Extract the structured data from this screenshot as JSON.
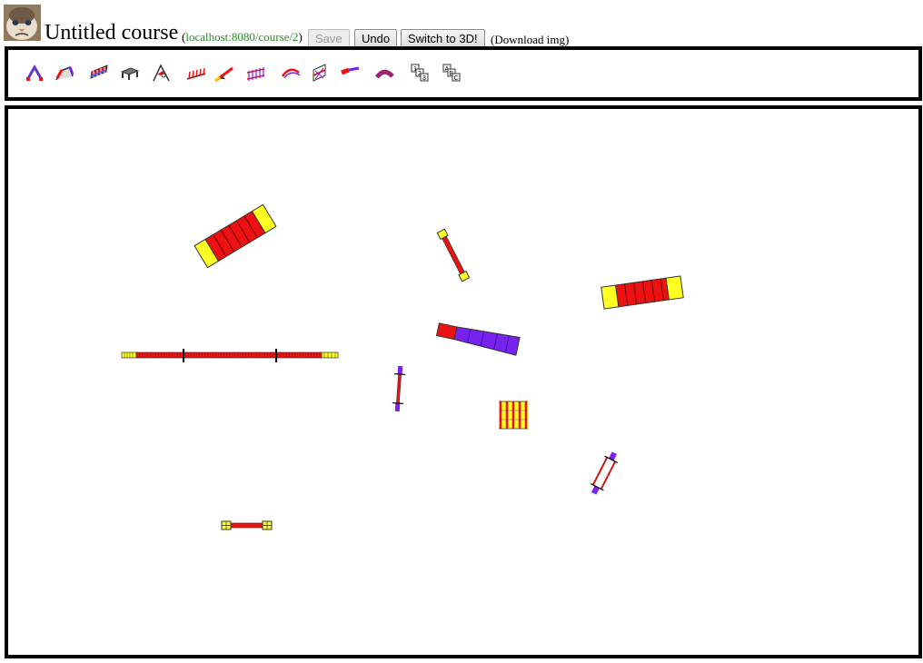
{
  "header": {
    "title": "Untitled course",
    "open_paren": "(",
    "url": "localhost:8080/course/2",
    "close_paren": ")",
    "buttons": {
      "save": "Save",
      "undo": "Undo",
      "switch_3d": "Switch to 3D!"
    },
    "download_open": "(",
    "download": "Download img",
    "download_close": ")",
    "avatar": "grumpy-cat-avatar"
  },
  "colors": {
    "border": "#000000",
    "contact_red": "#ee1111",
    "contact_yellow": "#ffff22",
    "tunnel_purple": "#7722ee",
    "url_green": "#2a8a2a"
  },
  "toolbar": {
    "tools": [
      "a-frame-icon",
      "dog-walk-icon",
      "wall-jump-icon",
      "table-icon",
      "tire-jump-icon",
      "weave-poles-icon",
      "teeter-icon",
      "double-jump-icon",
      "tunnel-curve-icon",
      "panel-jump-icon",
      "chute-icon",
      "curved-tunnel-icon",
      "number-cones-icon",
      "letter-cones-icon"
    ]
  }
}
